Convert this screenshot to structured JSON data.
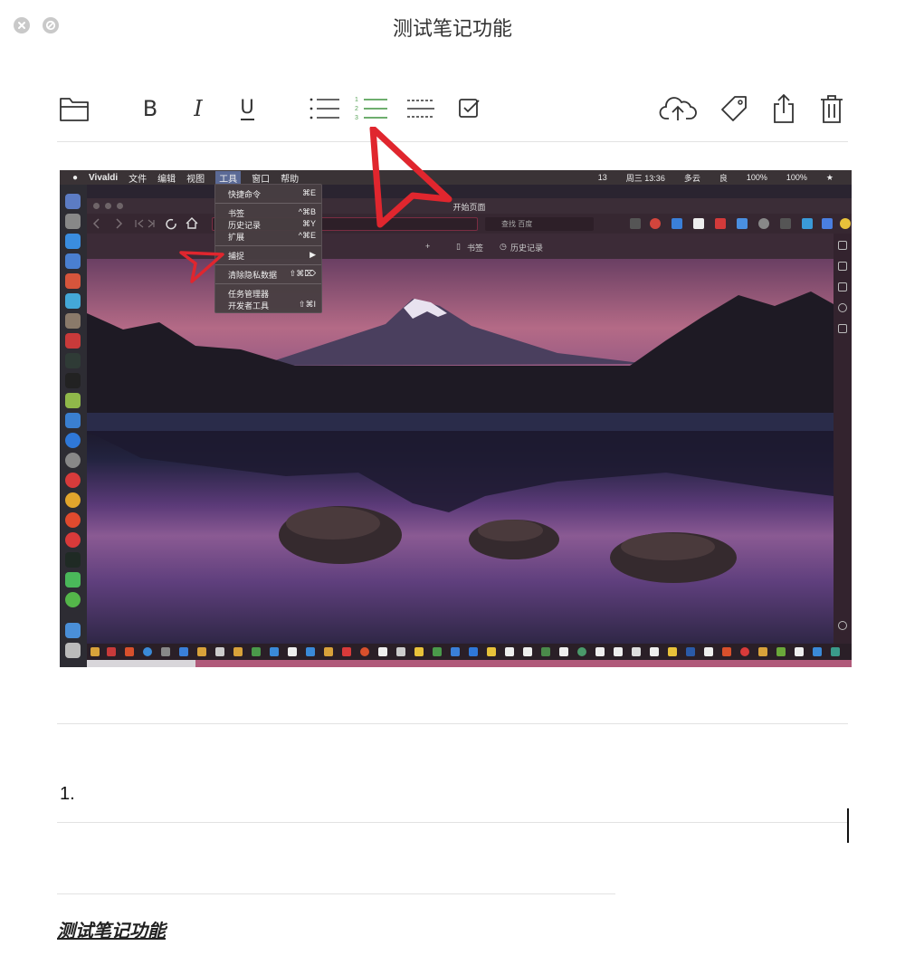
{
  "window": {
    "title": "测试笔记功能"
  },
  "toolbar": {
    "bold_label": "B",
    "italic_label": "I",
    "underline_label": "U",
    "numbered_list_digits": [
      "1",
      "2",
      "3"
    ],
    "accent_color": "#5aa35a"
  },
  "screenshot": {
    "mac_menubar": {
      "items": [
        "Vivaldi",
        "文件",
        "编辑",
        "视图",
        "工具",
        "窗口",
        "帮助"
      ],
      "status": [
        "13",
        "周三 13:36",
        "多云",
        "良",
        "100%",
        "100%"
      ]
    },
    "browser": {
      "page_title": "开始页面",
      "search_placeholder": "查找 百度",
      "bookmarks_label": "书签",
      "history_label": "历史记录",
      "add_symbol": "+"
    },
    "tools_menu": {
      "items": [
        {
          "label": "快捷命令",
          "shortcut": "⌘E"
        },
        {
          "label": "书签",
          "shortcut": "^⌘B"
        },
        {
          "label": "历史记录",
          "shortcut": "⌘Y"
        },
        {
          "label": "扩展",
          "shortcut": "^⌘E"
        },
        {
          "label": "捕捉",
          "shortcut": "▶"
        },
        {
          "label": "清除隐私数据",
          "shortcut": "⇧⌘⌦"
        },
        {
          "label": "任务管理器",
          "shortcut": ""
        },
        {
          "label": "开发者工具",
          "shortcut": "⇧⌘I"
        }
      ]
    }
  },
  "note": {
    "list_number": "1.",
    "title_text": "测试笔记功能"
  },
  "colors": {
    "annotation_red": "#e0262e",
    "divider": "#e2e2e2"
  }
}
